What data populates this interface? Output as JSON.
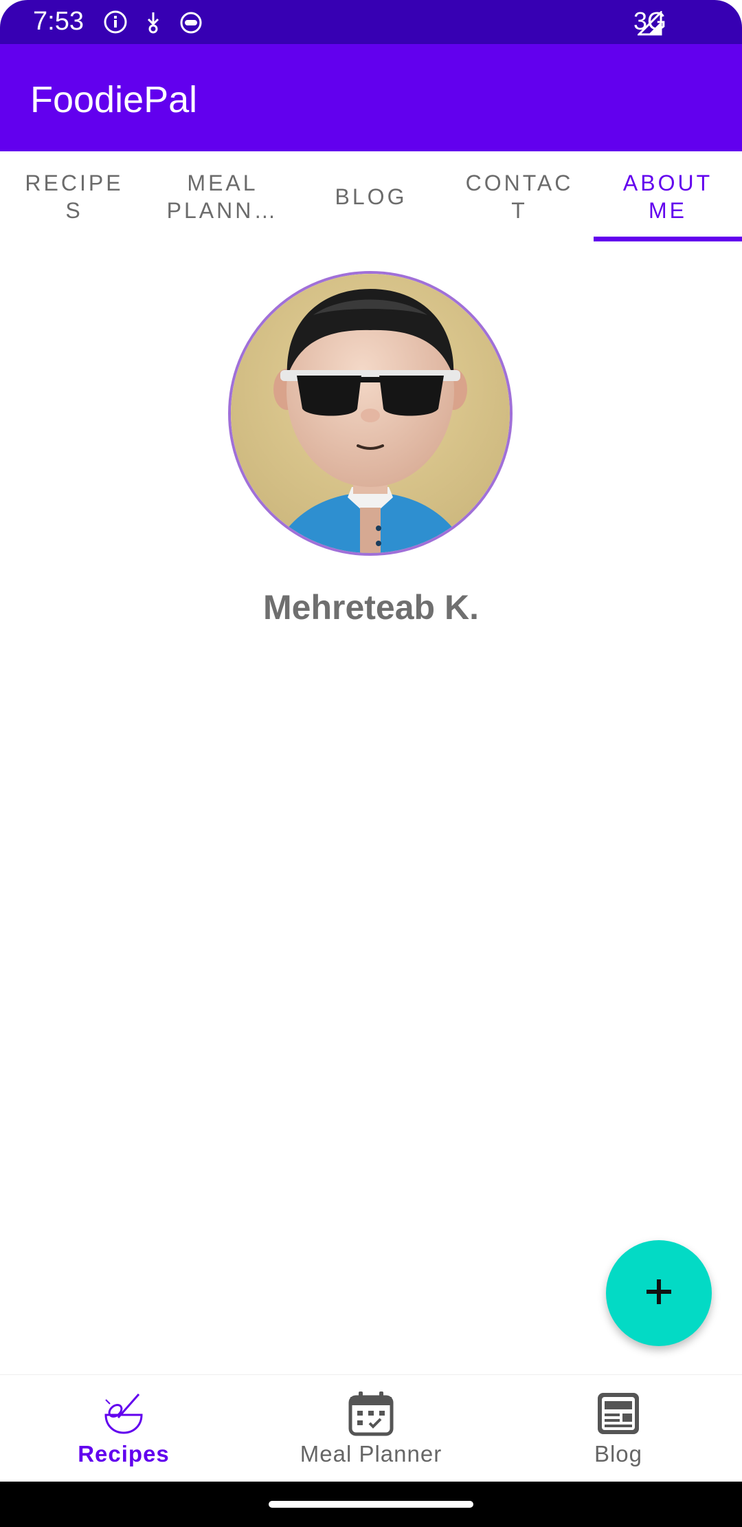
{
  "status_bar": {
    "time": "7:53",
    "network": "3G",
    "icons": [
      "info-icon",
      "download-icon",
      "cat-face-icon",
      "signal-icon"
    ]
  },
  "app_bar": {
    "title": "FoodiePal"
  },
  "tabs": [
    {
      "label": "RECIPE\nS",
      "active": false
    },
    {
      "label": "MEAL\nPLANN…",
      "active": false
    },
    {
      "label": "BLOG",
      "active": false
    },
    {
      "label": "CONTAC\nT",
      "active": false
    },
    {
      "label": "ABOUT\nME",
      "active": true
    }
  ],
  "profile": {
    "name": "Mehreteab K.",
    "avatar": "cartoon-avatar-with-sunglasses"
  },
  "fab": {
    "icon": "plus-icon"
  },
  "bottom_nav": [
    {
      "label": "Recipes",
      "icon": "mixing-bowl-icon",
      "active": true
    },
    {
      "label": "Meal Planner",
      "icon": "calendar-icon",
      "active": false
    },
    {
      "label": "Blog",
      "icon": "blog-icon",
      "active": false
    }
  ],
  "colors": {
    "status_bar": "#3700b3",
    "primary": "#6200ee",
    "accent": "#03dac5",
    "tab_inactive": "#6b6b6b",
    "name_text": "#6f6f6f"
  }
}
